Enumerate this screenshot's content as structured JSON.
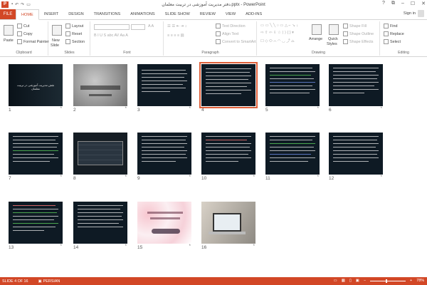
{
  "window": {
    "title": "دفتر مدیریت آموزشی در تربیت معلمان.pptx - PowerPoint",
    "controls": [
      "?",
      "⧉",
      "–",
      "☐",
      "✕"
    ],
    "qat_icons": [
      "save-icon",
      "undo-icon",
      "redo-icon",
      "start-slideshow-icon"
    ]
  },
  "tabs": [
    {
      "label": "FILE"
    },
    {
      "label": "HOME"
    },
    {
      "label": "INSERT"
    },
    {
      "label": "DESIGN"
    },
    {
      "label": "TRANSITIONS"
    },
    {
      "label": "ANIMATIONS"
    },
    {
      "label": "SLIDE SHOW"
    },
    {
      "label": "REVIEW"
    },
    {
      "label": "VIEW"
    },
    {
      "label": "ADD-INS"
    }
  ],
  "active_tab": "HOME",
  "signin": "Sign in",
  "ribbon": {
    "clipboard": {
      "label": "Clipboard",
      "paste": "Paste",
      "cut": "Cut",
      "copy": "Copy",
      "format_painter": "Format Painter"
    },
    "slides": {
      "label": "Slides",
      "new_slide": "New",
      "new_slide2": "Slide",
      "layout": "Layout",
      "reset": "Reset",
      "section": "Section"
    },
    "font": {
      "label": "Font"
    },
    "paragraph": {
      "label": "Paragraph",
      "text_direction": "Text Direction",
      "align_text": "Align Text",
      "convert": "Convert to SmartArt"
    },
    "drawing": {
      "label": "Drawing",
      "arrange": "Arrange",
      "quick_styles": "Quick",
      "quick_styles2": "Styles",
      "shape_fill": "Shape Fill",
      "shape_outline": "Shape Outline",
      "shape_effects": "Shape Effects"
    },
    "editing": {
      "label": "Editing",
      "find": "Find",
      "replace": "Replace",
      "select": "Select"
    }
  },
  "slides": [
    {
      "number": "1",
      "title": "نقش مدیریت آموزشی در تربیت معلمان"
    },
    {
      "number": "2"
    },
    {
      "number": "3"
    },
    {
      "number": "4"
    },
    {
      "number": "5"
    },
    {
      "number": "6"
    },
    {
      "number": "7"
    },
    {
      "number": "8"
    },
    {
      "number": "9"
    },
    {
      "number": "10"
    },
    {
      "number": "11"
    },
    {
      "number": "12"
    },
    {
      "number": "13"
    },
    {
      "number": "14"
    },
    {
      "number": "15"
    },
    {
      "number": "16"
    }
  ],
  "selected_slide": "4",
  "transition_marker": "*",
  "status": {
    "slide_of": "SLIDE 4 OF 16",
    "language": "PERSIAN",
    "zoom": "78%"
  },
  "colors": {
    "accent": "#d24726",
    "slide_bg": "#0e1a24"
  }
}
